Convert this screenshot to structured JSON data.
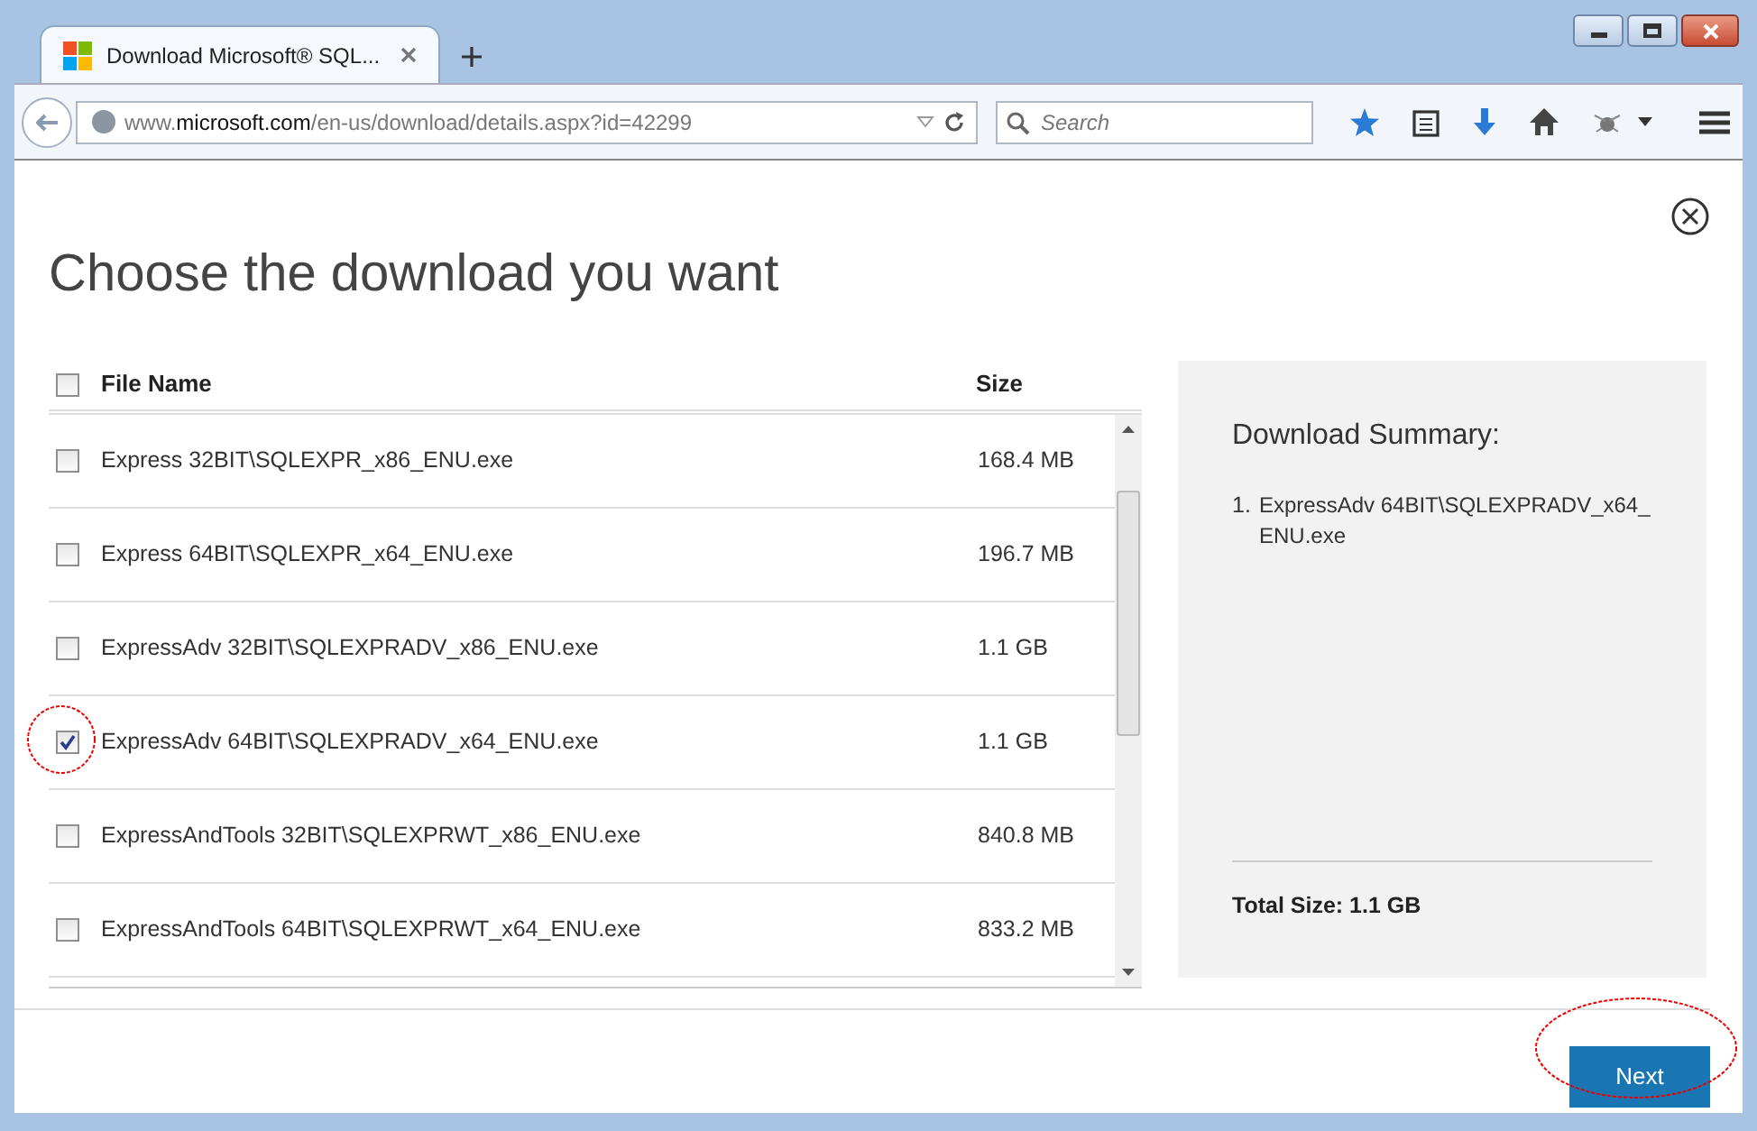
{
  "browser": {
    "tab_title": "Download Microsoft® SQL...",
    "url_host_prefix": "www.",
    "url_host": "microsoft.com",
    "url_path": "/en-us/download/details.aspx?id=42299",
    "search_placeholder": "Search"
  },
  "page": {
    "heading": "Choose the download you want",
    "table": {
      "header_checked": false,
      "columns": [
        "File Name",
        "Size"
      ],
      "rows": [
        {
          "name": "Express 32BIT\\SQLEXPR_x86_ENU.exe",
          "size": "168.4 MB",
          "checked": false
        },
        {
          "name": "Express 64BIT\\SQLEXPR_x64_ENU.exe",
          "size": "196.7 MB",
          "checked": false
        },
        {
          "name": "ExpressAdv 32BIT\\SQLEXPRADV_x86_ENU.exe",
          "size": "1.1 GB",
          "checked": false
        },
        {
          "name": "ExpressAdv 64BIT\\SQLEXPRADV_x64_ENU.exe",
          "size": "1.1 GB",
          "checked": true
        },
        {
          "name": "ExpressAndTools 32BIT\\SQLEXPRWT_x86_ENU.exe",
          "size": "840.8 MB",
          "checked": false
        },
        {
          "name": "ExpressAndTools 64BIT\\SQLEXPRWT_x64_ENU.exe",
          "size": "833.2 MB",
          "checked": false
        }
      ]
    },
    "summary": {
      "title": "Download Summary:",
      "items": [
        {
          "number": "1.",
          "name": "ExpressAdv 64BIT\\SQLEXPRADV_x64_ENU.exe"
        }
      ],
      "total": "Total Size: 1.1 GB"
    },
    "next_button": "Next"
  }
}
